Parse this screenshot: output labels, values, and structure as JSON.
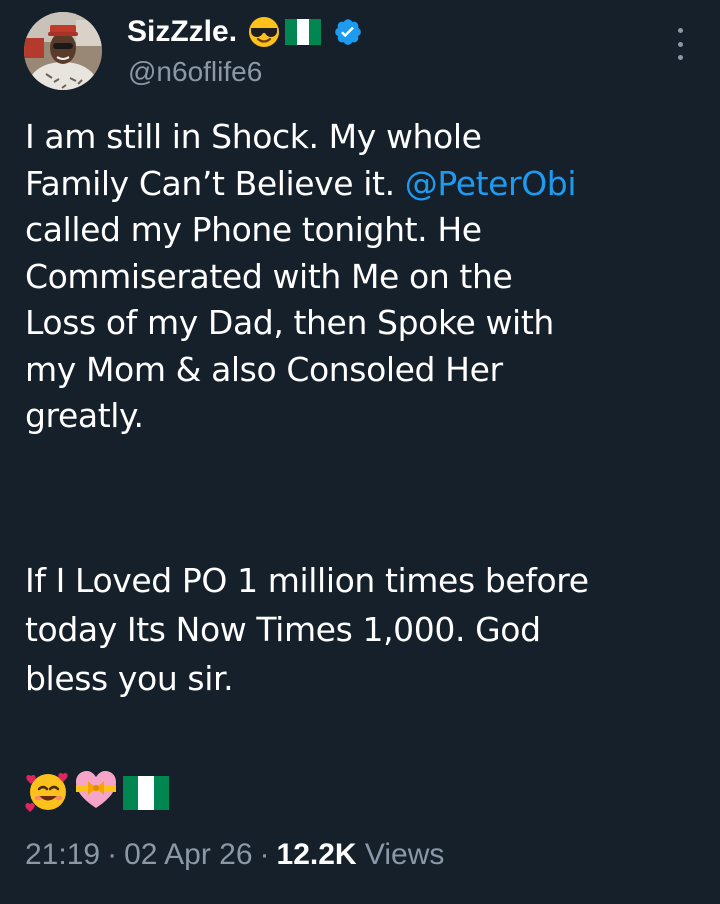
{
  "user": {
    "display_name": "SizZzle.",
    "handle": "@n6oflife6",
    "name_emoji": "sunglasses-face-emoji",
    "flag": "nigeria-flag",
    "verified_icon": "verified-badge-icon"
  },
  "tweet": {
    "lines": [
      "I am still in Shock. My whole",
      "Family Can’t Believe it. ",
      "called my Phone tonight. He",
      "Commiserated with Me on the",
      "Loss of my Dad, then Spoke with",
      "my Mom & also Consoled Her",
      "greatly."
    ],
    "mention": "@PeterObi",
    "paragraph2_lines": [
      "If I Loved PO 1 million times before",
      "today Its Now Times 1,000. God",
      "bless you sir."
    ],
    "emojis": [
      "smiling-face-with-hearts-emoji",
      "heart-with-ribbon-emoji",
      "nigeria-flag"
    ]
  },
  "meta": {
    "time": "21:19",
    "date": "02 Apr 26",
    "separator": "·",
    "views_count": "12.2K",
    "views_label": "Views"
  },
  "colors": {
    "background": "#15202b",
    "text": "#ffffff",
    "secondary_text": "#8b98a5",
    "link": "#1d9bf0",
    "verified": "#1d9bf0",
    "flag_green": "#008751"
  }
}
